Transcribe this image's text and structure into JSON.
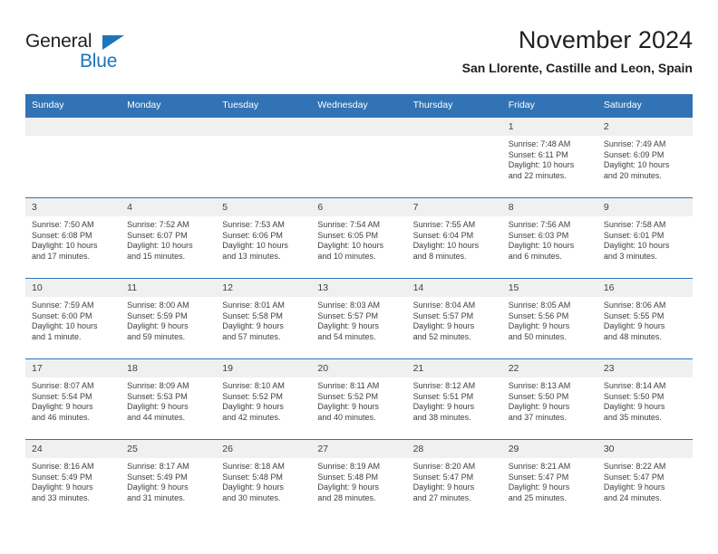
{
  "brand": {
    "word_top": "General",
    "word_bottom": "Blue",
    "triangle_color": "#1b75bb",
    "text_color": "#231f20"
  },
  "header": {
    "title": "November 2024",
    "subtitle": "San Llorente, Castille and Leon, Spain"
  },
  "theme": {
    "header_blue": "#3173b5",
    "number_band_gray": "#f0f0f0",
    "text_gray": "#404040"
  },
  "weekdays": [
    "Sunday",
    "Monday",
    "Tuesday",
    "Wednesday",
    "Thursday",
    "Friday",
    "Saturday"
  ],
  "labels": {
    "sunrise_prefix": "Sunrise:",
    "sunset_prefix": "Sunset:",
    "daylight_prefix": "Daylight:"
  },
  "weeks": [
    {
      "days": [
        {
          "num": "",
          "sunrise": "",
          "sunset": "",
          "daylight_a": "",
          "daylight_b": ""
        },
        {
          "num": "",
          "sunrise": "",
          "sunset": "",
          "daylight_a": "",
          "daylight_b": ""
        },
        {
          "num": "",
          "sunrise": "",
          "sunset": "",
          "daylight_a": "",
          "daylight_b": ""
        },
        {
          "num": "",
          "sunrise": "",
          "sunset": "",
          "daylight_a": "",
          "daylight_b": ""
        },
        {
          "num": "",
          "sunrise": "",
          "sunset": "",
          "daylight_a": "",
          "daylight_b": ""
        },
        {
          "num": "1",
          "sunrise": "Sunrise: 7:48 AM",
          "sunset": "Sunset: 6:11 PM",
          "daylight_a": "Daylight: 10 hours",
          "daylight_b": "and 22 minutes."
        },
        {
          "num": "2",
          "sunrise": "Sunrise: 7:49 AM",
          "sunset": "Sunset: 6:09 PM",
          "daylight_a": "Daylight: 10 hours",
          "daylight_b": "and 20 minutes."
        }
      ]
    },
    {
      "days": [
        {
          "num": "3",
          "sunrise": "Sunrise: 7:50 AM",
          "sunset": "Sunset: 6:08 PM",
          "daylight_a": "Daylight: 10 hours",
          "daylight_b": "and 17 minutes."
        },
        {
          "num": "4",
          "sunrise": "Sunrise: 7:52 AM",
          "sunset": "Sunset: 6:07 PM",
          "daylight_a": "Daylight: 10 hours",
          "daylight_b": "and 15 minutes."
        },
        {
          "num": "5",
          "sunrise": "Sunrise: 7:53 AM",
          "sunset": "Sunset: 6:06 PM",
          "daylight_a": "Daylight: 10 hours",
          "daylight_b": "and 13 minutes."
        },
        {
          "num": "6",
          "sunrise": "Sunrise: 7:54 AM",
          "sunset": "Sunset: 6:05 PM",
          "daylight_a": "Daylight: 10 hours",
          "daylight_b": "and 10 minutes."
        },
        {
          "num": "7",
          "sunrise": "Sunrise: 7:55 AM",
          "sunset": "Sunset: 6:04 PM",
          "daylight_a": "Daylight: 10 hours",
          "daylight_b": "and 8 minutes."
        },
        {
          "num": "8",
          "sunrise": "Sunrise: 7:56 AM",
          "sunset": "Sunset: 6:03 PM",
          "daylight_a": "Daylight: 10 hours",
          "daylight_b": "and 6 minutes."
        },
        {
          "num": "9",
          "sunrise": "Sunrise: 7:58 AM",
          "sunset": "Sunset: 6:01 PM",
          "daylight_a": "Daylight: 10 hours",
          "daylight_b": "and 3 minutes."
        }
      ]
    },
    {
      "days": [
        {
          "num": "10",
          "sunrise": "Sunrise: 7:59 AM",
          "sunset": "Sunset: 6:00 PM",
          "daylight_a": "Daylight: 10 hours",
          "daylight_b": "and 1 minute."
        },
        {
          "num": "11",
          "sunrise": "Sunrise: 8:00 AM",
          "sunset": "Sunset: 5:59 PM",
          "daylight_a": "Daylight: 9 hours",
          "daylight_b": "and 59 minutes."
        },
        {
          "num": "12",
          "sunrise": "Sunrise: 8:01 AM",
          "sunset": "Sunset: 5:58 PM",
          "daylight_a": "Daylight: 9 hours",
          "daylight_b": "and 57 minutes."
        },
        {
          "num": "13",
          "sunrise": "Sunrise: 8:03 AM",
          "sunset": "Sunset: 5:57 PM",
          "daylight_a": "Daylight: 9 hours",
          "daylight_b": "and 54 minutes."
        },
        {
          "num": "14",
          "sunrise": "Sunrise: 8:04 AM",
          "sunset": "Sunset: 5:57 PM",
          "daylight_a": "Daylight: 9 hours",
          "daylight_b": "and 52 minutes."
        },
        {
          "num": "15",
          "sunrise": "Sunrise: 8:05 AM",
          "sunset": "Sunset: 5:56 PM",
          "daylight_a": "Daylight: 9 hours",
          "daylight_b": "and 50 minutes."
        },
        {
          "num": "16",
          "sunrise": "Sunrise: 8:06 AM",
          "sunset": "Sunset: 5:55 PM",
          "daylight_a": "Daylight: 9 hours",
          "daylight_b": "and 48 minutes."
        }
      ]
    },
    {
      "days": [
        {
          "num": "17",
          "sunrise": "Sunrise: 8:07 AM",
          "sunset": "Sunset: 5:54 PM",
          "daylight_a": "Daylight: 9 hours",
          "daylight_b": "and 46 minutes."
        },
        {
          "num": "18",
          "sunrise": "Sunrise: 8:09 AM",
          "sunset": "Sunset: 5:53 PM",
          "daylight_a": "Daylight: 9 hours",
          "daylight_b": "and 44 minutes."
        },
        {
          "num": "19",
          "sunrise": "Sunrise: 8:10 AM",
          "sunset": "Sunset: 5:52 PM",
          "daylight_a": "Daylight: 9 hours",
          "daylight_b": "and 42 minutes."
        },
        {
          "num": "20",
          "sunrise": "Sunrise: 8:11 AM",
          "sunset": "Sunset: 5:52 PM",
          "daylight_a": "Daylight: 9 hours",
          "daylight_b": "and 40 minutes."
        },
        {
          "num": "21",
          "sunrise": "Sunrise: 8:12 AM",
          "sunset": "Sunset: 5:51 PM",
          "daylight_a": "Daylight: 9 hours",
          "daylight_b": "and 38 minutes."
        },
        {
          "num": "22",
          "sunrise": "Sunrise: 8:13 AM",
          "sunset": "Sunset: 5:50 PM",
          "daylight_a": "Daylight: 9 hours",
          "daylight_b": "and 37 minutes."
        },
        {
          "num": "23",
          "sunrise": "Sunrise: 8:14 AM",
          "sunset": "Sunset: 5:50 PM",
          "daylight_a": "Daylight: 9 hours",
          "daylight_b": "and 35 minutes."
        }
      ]
    },
    {
      "days": [
        {
          "num": "24",
          "sunrise": "Sunrise: 8:16 AM",
          "sunset": "Sunset: 5:49 PM",
          "daylight_a": "Daylight: 9 hours",
          "daylight_b": "and 33 minutes."
        },
        {
          "num": "25",
          "sunrise": "Sunrise: 8:17 AM",
          "sunset": "Sunset: 5:49 PM",
          "daylight_a": "Daylight: 9 hours",
          "daylight_b": "and 31 minutes."
        },
        {
          "num": "26",
          "sunrise": "Sunrise: 8:18 AM",
          "sunset": "Sunset: 5:48 PM",
          "daylight_a": "Daylight: 9 hours",
          "daylight_b": "and 30 minutes."
        },
        {
          "num": "27",
          "sunrise": "Sunrise: 8:19 AM",
          "sunset": "Sunset: 5:48 PM",
          "daylight_a": "Daylight: 9 hours",
          "daylight_b": "and 28 minutes."
        },
        {
          "num": "28",
          "sunrise": "Sunrise: 8:20 AM",
          "sunset": "Sunset: 5:47 PM",
          "daylight_a": "Daylight: 9 hours",
          "daylight_b": "and 27 minutes."
        },
        {
          "num": "29",
          "sunrise": "Sunrise: 8:21 AM",
          "sunset": "Sunset: 5:47 PM",
          "daylight_a": "Daylight: 9 hours",
          "daylight_b": "and 25 minutes."
        },
        {
          "num": "30",
          "sunrise": "Sunrise: 8:22 AM",
          "sunset": "Sunset: 5:47 PM",
          "daylight_a": "Daylight: 9 hours",
          "daylight_b": "and 24 minutes."
        }
      ]
    }
  ]
}
